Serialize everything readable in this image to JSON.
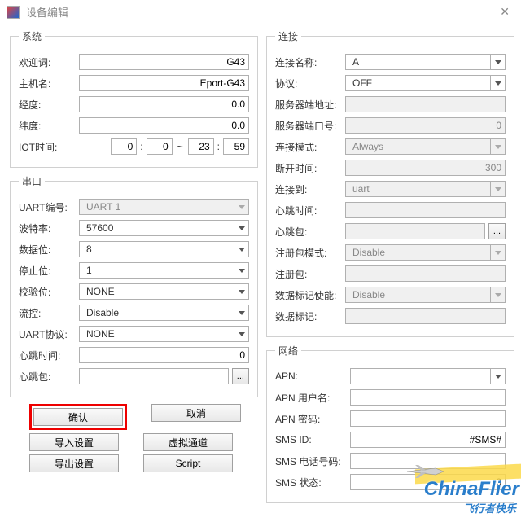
{
  "window": {
    "title": "设备编辑",
    "close": "✕"
  },
  "groups": {
    "system": "系统",
    "serial": "串口",
    "connection": "连接",
    "network": "网络"
  },
  "system": {
    "welcome_label": "欢迎词:",
    "welcome": "G43",
    "hostname_label": "主机名:",
    "hostname": "Eport-G43",
    "lon_label": "经度:",
    "lon": "0.0",
    "lat_label": "纬度:",
    "lat": "0.0",
    "iot_label": "IOT时间:",
    "iot_h1": "0",
    "iot_m1": "0",
    "iot_h2": "23",
    "iot_m2": "59"
  },
  "serial": {
    "uartno_label": "UART编号:",
    "uartno": "UART 1",
    "baud_label": "波特率:",
    "baud": "57600",
    "databits_label": "数据位:",
    "databits": "8",
    "stopbits_label": "停止位:",
    "stopbits": "1",
    "parity_label": "校验位:",
    "parity": "NONE",
    "flow_label": "流控:",
    "flow": "Disable",
    "uartproto_label": "UART协议:",
    "uartproto": "NONE",
    "hb_time_label": "心跳时间:",
    "hb_time": "0",
    "hb_pkt_label": "心跳包:",
    "hb_pkt": ""
  },
  "connection": {
    "name_label": "连接名称:",
    "name": "A",
    "proto_label": "协议:",
    "proto": "OFF",
    "server_addr_label": "服务器端地址:",
    "server_addr": "",
    "server_port_label": "服务器端口号:",
    "server_port": "0",
    "conn_mode_label": "连接模式:",
    "conn_mode": "Always",
    "disc_time_label": "断开时间:",
    "disc_time": "300",
    "conn_to_label": "连接到:",
    "conn_to": "uart",
    "hb_time_label": "心跳时间:",
    "hb_time": "",
    "hb_pkt_label": "心跳包:",
    "hb_pkt": "",
    "reg_mode_label": "注册包模式:",
    "reg_mode": "Disable",
    "reg_pkt_label": "注册包:",
    "reg_pkt": "",
    "tag_enable_label": "数据标记使能:",
    "tag_enable": "Disable",
    "tag_label": "数据标记:",
    "tag": ""
  },
  "network": {
    "apn_label": "APN:",
    "apn": "",
    "apn_user_label": "APN 用户名:",
    "apn_user": "",
    "apn_pass_label": "APN 密码:",
    "apn_pass": "",
    "sms_id_label": "SMS ID:",
    "sms_id": "#SMS#",
    "sms_phone_label": "SMS 电话号码:",
    "sms_phone": "",
    "sms_status_label": "SMS 状态:",
    "sms_status": "0"
  },
  "buttons": {
    "ok": "确认",
    "cancel": "取消",
    "import": "导入设置",
    "vchan": "虚拟通道",
    "export": "导出设置",
    "script": "Script",
    "dots": "..."
  },
  "watermark": {
    "main": "ChinaFlier",
    "sub": "飞行者快乐"
  }
}
